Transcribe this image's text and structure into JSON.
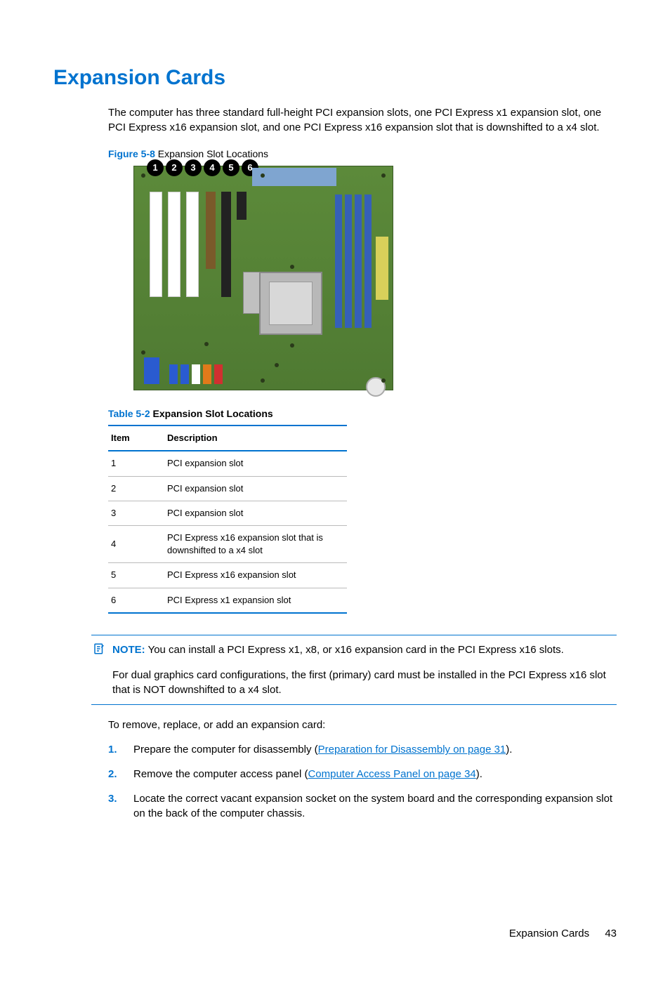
{
  "heading": "Expansion Cards",
  "intro": "The computer has three standard full-height PCI expansion slots, one PCI Express x1 expansion slot, one PCI Express x16 expansion slot, and one PCI Express x16 expansion slot that is downshifted to a x4 slot.",
  "figure": {
    "label": "Figure 5-8",
    "title": "Expansion Slot Locations",
    "callouts": [
      "1",
      "2",
      "3",
      "4",
      "5",
      "6"
    ]
  },
  "table": {
    "label": "Table 5-2",
    "title": "Expansion Slot Locations",
    "headers": {
      "item": "Item",
      "desc": "Description"
    },
    "rows": [
      {
        "item": "1",
        "desc": "PCI expansion slot"
      },
      {
        "item": "2",
        "desc": "PCI expansion slot"
      },
      {
        "item": "3",
        "desc": "PCI expansion slot"
      },
      {
        "item": "4",
        "desc": "PCI Express x16 expansion slot that is downshifted to a x4 slot"
      },
      {
        "item": "5",
        "desc": "PCI Express x16 expansion slot"
      },
      {
        "item": "6",
        "desc": "PCI Express x1 expansion slot"
      }
    ]
  },
  "note": {
    "label": "NOTE:",
    "text": "You can install a PCI Express x1, x8, or x16 expansion card in the PCI Express x16 slots.",
    "followup": "For dual graphics card configurations, the first (primary) card must be installed in the PCI Express x16 slot that is NOT downshifted to a x4 slot."
  },
  "afterNote": "To remove, replace, or add an expansion card:",
  "steps": [
    {
      "num": "1.",
      "pre": "Prepare the computer for disassembly (",
      "link": "Preparation for Disassembly on page 31",
      "post": ")."
    },
    {
      "num": "2.",
      "pre": "Remove the computer access panel (",
      "link": "Computer Access Panel on page 34",
      "post": ")."
    },
    {
      "num": "3.",
      "pre": "Locate the correct vacant expansion socket on the system board and the corresponding expansion slot on the back of the computer chassis.",
      "link": "",
      "post": ""
    }
  ],
  "footer": {
    "section": "Expansion Cards",
    "page": "43"
  }
}
